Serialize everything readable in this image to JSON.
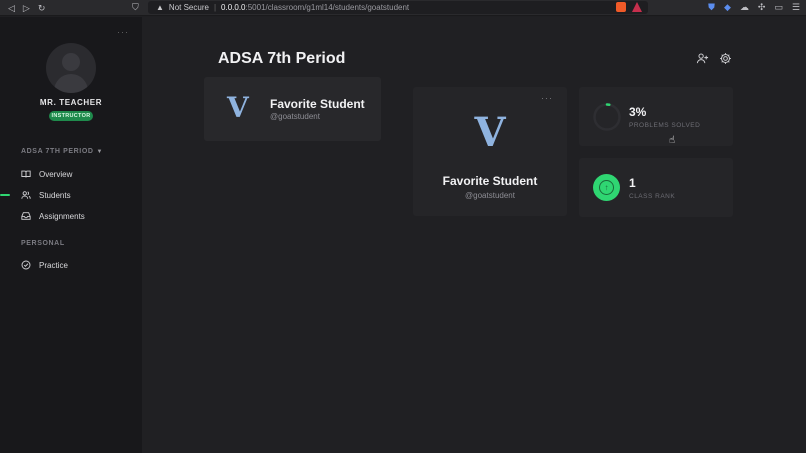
{
  "browser": {
    "security_label": "Not Secure",
    "url_host": "0.0.0.0",
    "url_path": ":5001/classroom/g1ml14/students/goatstudent"
  },
  "sidebar": {
    "teacher_name": "MR. TEACHER",
    "role_badge": "INSTRUCTOR",
    "class_name": "ADSA 7TH PERIOD",
    "nav_items": [
      {
        "label": "Overview",
        "icon": "book-icon",
        "active": false
      },
      {
        "label": "Students",
        "icon": "users-icon",
        "active": true
      },
      {
        "label": "Assignments",
        "icon": "inbox-icon",
        "active": false
      }
    ],
    "personal_heading": "PERSONAL",
    "personal_items": [
      {
        "label": "Practice",
        "icon": "check-circle-icon"
      }
    ]
  },
  "main": {
    "page_title": "ADSA 7th Period",
    "student_list": [
      {
        "logo_letter": "V",
        "name": "Favorite Student",
        "username": "@goatstudent"
      }
    ],
    "profile": {
      "logo_letter": "V",
      "name": "Favorite Student",
      "username": "@goatstudent"
    },
    "stats": {
      "problems_solved_value": "3%",
      "problems_solved_label": "PROBLEMS SOLVED",
      "problems_solved_fraction": 0.03,
      "class_rank_value": "1",
      "class_rank_label": "CLASS RANK"
    }
  },
  "colors": {
    "accent_green": "#2fd672",
    "logo_blue": "#8fb3df",
    "sidebar_bg": "#18181b",
    "main_bg": "#202023",
    "card_bg": "#252528"
  }
}
